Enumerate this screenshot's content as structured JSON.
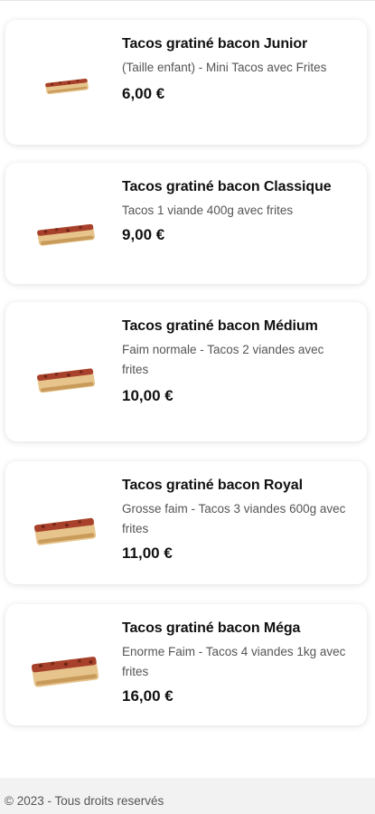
{
  "products": [
    {
      "title": "Tacos gratiné bacon Junior",
      "description": "(Taille enfant) - Mini Tacos avec Frites",
      "price": "6,00 €",
      "image_icon": "tacos-image"
    },
    {
      "title": "Tacos gratiné bacon Classique",
      "description": "Tacos 1 viande 400g avec  frites",
      "price": "9,00 €",
      "image_icon": "tacos-image"
    },
    {
      "title": "Tacos gratiné bacon Médium",
      "description": "Faim normale - Tacos 2 viandes avec frites",
      "price": "10,00 €",
      "image_icon": "tacos-image"
    },
    {
      "title": "Tacos gratiné bacon Royal",
      "description": "Grosse faim - Tacos 3 viandes 600g avec frites",
      "price": "11,00 €",
      "image_icon": "tacos-image"
    },
    {
      "title": "Tacos gratiné bacon Méga",
      "description": "Enorme Faim - Tacos 4 viandes 1kg avec  frites",
      "price": "16,00 €",
      "image_icon": "tacos-image"
    }
  ],
  "footer": {
    "copyright": "© 2023 - Tous droits reservés"
  },
  "colors": {
    "card_background": "#ffffff",
    "footer_background": "#f2f2f2",
    "text_primary": "#111111",
    "text_secondary": "#555555"
  }
}
